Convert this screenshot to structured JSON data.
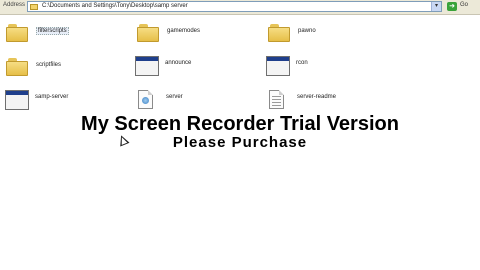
{
  "address_bar": {
    "label": "Address",
    "path": "C:\\Documents and Settings\\Tony\\Desktop\\samp server",
    "go_label": "Go"
  },
  "items": [
    {
      "name": "filterscripts",
      "type": "folder"
    },
    {
      "name": "gamemodes",
      "type": "folder"
    },
    {
      "name": "pawno",
      "type": "folder"
    },
    {
      "name": "scriptfiles",
      "type": "folder"
    },
    {
      "name": "announce",
      "type": "application"
    },
    {
      "name": "rcon",
      "type": "application"
    },
    {
      "name": "samp-server",
      "type": "application"
    },
    {
      "name": "server",
      "type": "config-document"
    },
    {
      "name": "server-readme",
      "type": "text-document"
    }
  ],
  "watermark": {
    "title": "My Screen Recorder Trial Version",
    "subtitle": "Please Purchase"
  }
}
